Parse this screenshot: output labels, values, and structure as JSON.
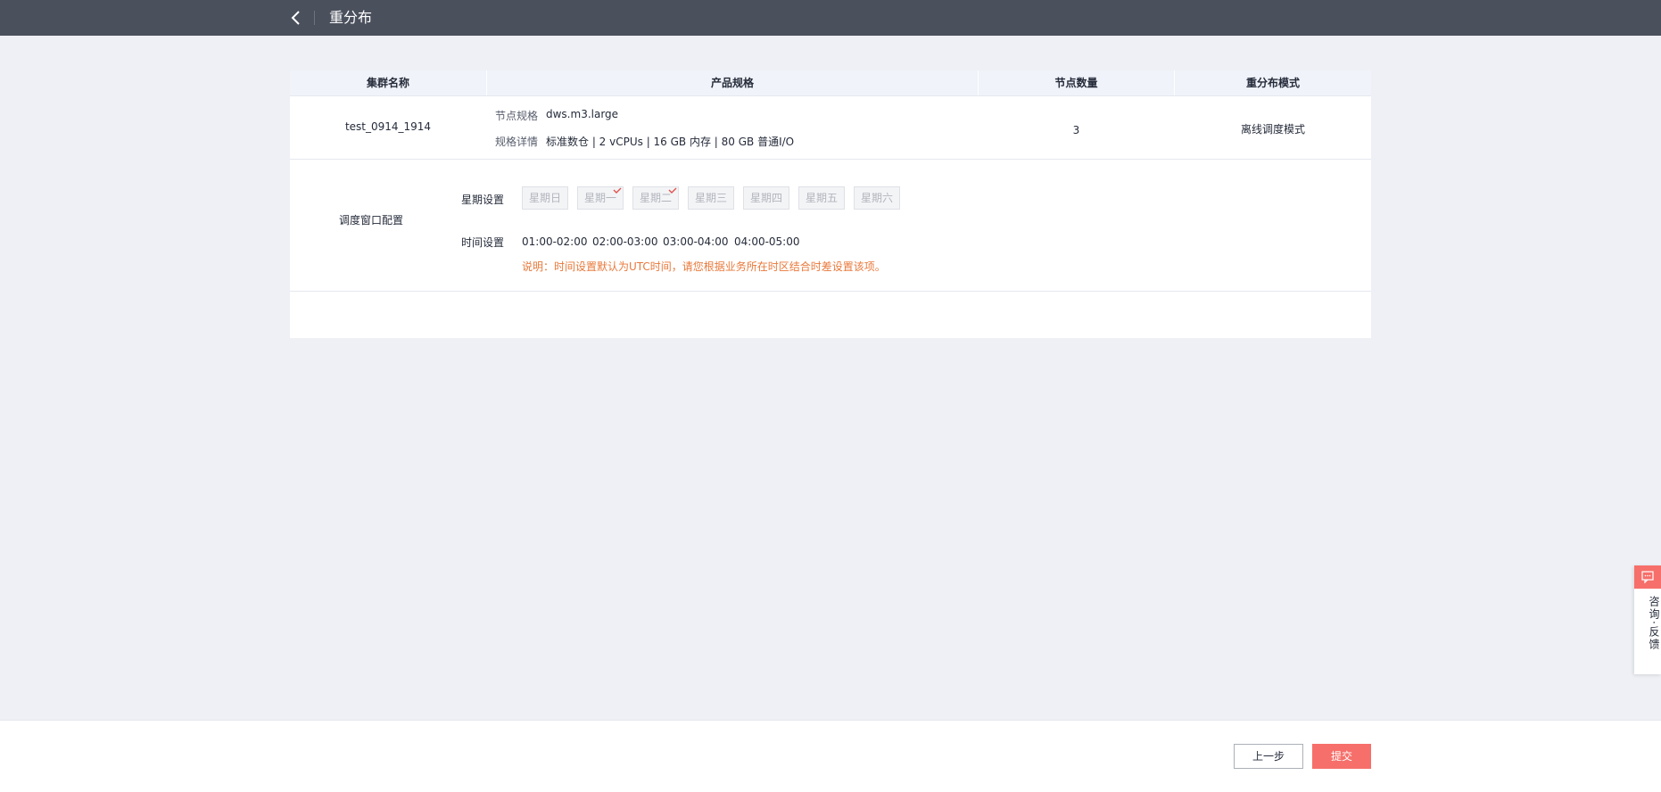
{
  "header": {
    "title": "重分布"
  },
  "table": {
    "columns": [
      "集群名称",
      "产品规格",
      "节点数量",
      "重分布模式"
    ],
    "row": {
      "cluster_name": "test_0914_1914",
      "spec_label": "节点规格",
      "spec_value": "dws.m3.large",
      "detail_label": "规格详情",
      "detail_value": "标准数仓 | 2 vCPUs | 16 GB 内存 | 80 GB 普通I/O",
      "node_count": "3",
      "mode": "离线调度模式"
    }
  },
  "schedule": {
    "section_label": "调度窗口配置",
    "weekday_label": "星期设置",
    "weekdays": [
      {
        "label": "星期日",
        "checked": false
      },
      {
        "label": "星期一",
        "checked": true
      },
      {
        "label": "星期二",
        "checked": true
      },
      {
        "label": "星期三",
        "checked": false
      },
      {
        "label": "星期四",
        "checked": false
      },
      {
        "label": "星期五",
        "checked": false
      },
      {
        "label": "星期六",
        "checked": false
      }
    ],
    "time_label": "时间设置",
    "times": [
      "01:00-02:00",
      "02:00-03:00",
      "03:00-04:00",
      "04:00-05:00"
    ],
    "note": "说明：时间设置默认为UTC时间，请您根据业务所在时区结合时差设置该项。"
  },
  "footer": {
    "prev_label": "上一步",
    "submit_label": "提交"
  },
  "feedback": {
    "label": "咨询·反馈"
  },
  "colors": {
    "header_bg": "#4b505d",
    "accent": "#f66f6a",
    "note": "#e8793b"
  }
}
